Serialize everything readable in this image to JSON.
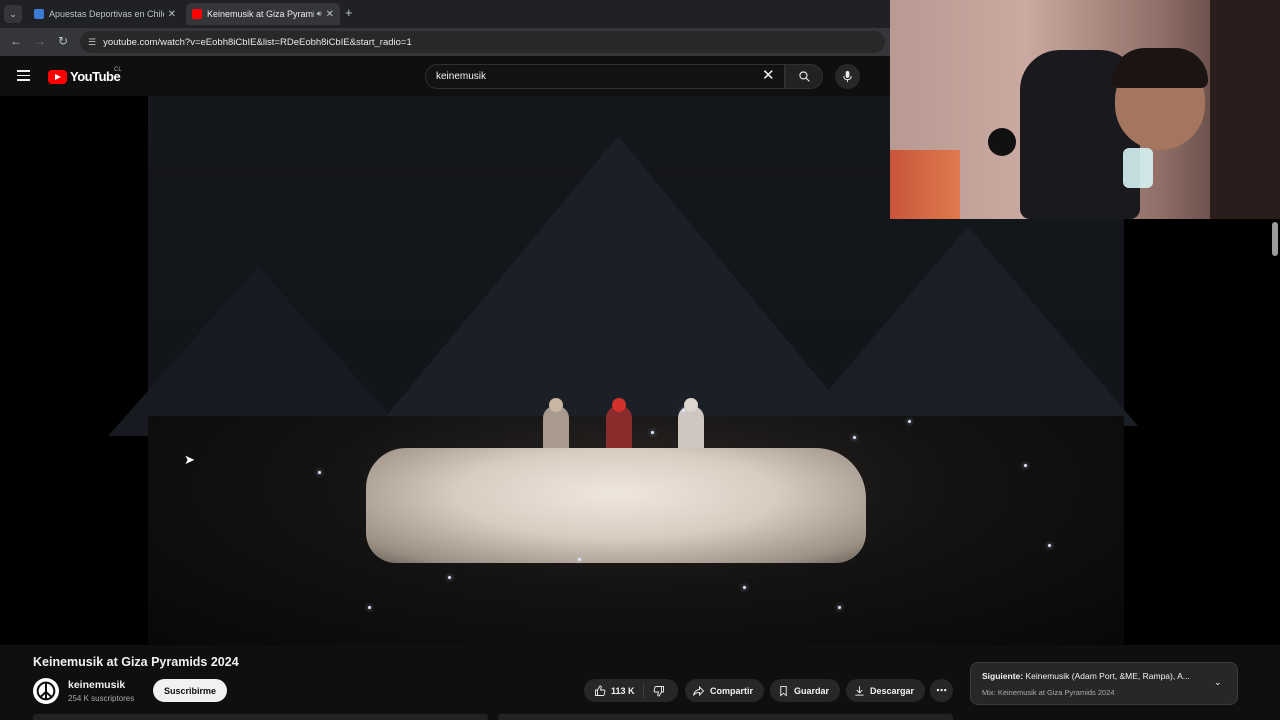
{
  "browser": {
    "tabs": [
      {
        "title": "Apuestas Deportivas en Chile |",
        "favicon_color": "#3b7bd6",
        "active": false
      },
      {
        "title": "Keinemusik at Giza Pyramid",
        "favicon_color": "#ff0000",
        "active": true
      }
    ],
    "url": "youtube.com/watch?v=eEobh8iCbIE&list=RDeEobh8iCbIE&start_radio=1"
  },
  "youtube": {
    "logo_text": "YouTube",
    "country_code": "CL",
    "search": {
      "value": "keinemusik"
    }
  },
  "video": {
    "title": "Keinemusik at Giza Pyramids 2024",
    "channel": {
      "name": "keinemusik",
      "subscribers": "254 K suscriptores"
    },
    "subscribe_label": "Suscribirme",
    "actions": {
      "likes": "113 K",
      "share": "Compartir",
      "save": "Guardar",
      "download": "Descargar"
    }
  },
  "up_next": {
    "label": "Siguiente:",
    "title": "Keinemusik (Adam Port, &ME, Rampa), A...",
    "playlist": "Mix: Keinemusik at Giza Pyramids 2024"
  },
  "colors": {
    "brand": "#ff0000",
    "background": "#0f0f0f",
    "pill": "#272727"
  }
}
